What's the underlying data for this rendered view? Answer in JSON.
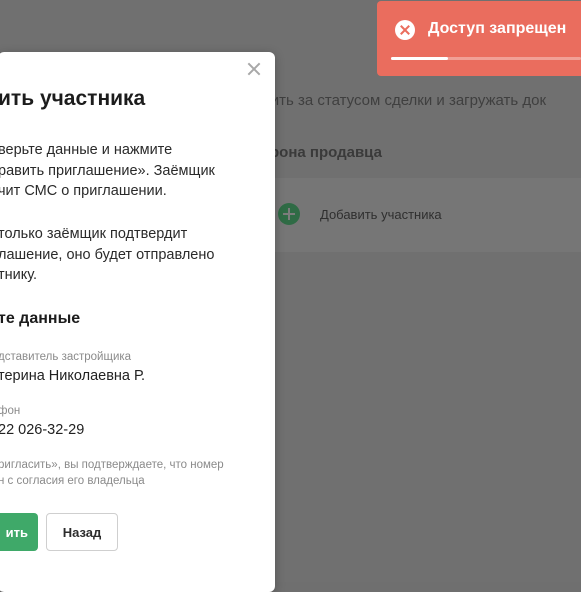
{
  "background": {
    "intro_text": "дить за статусом сделки и загружать док",
    "section_title": "рона продавца",
    "add_participant_label": "Добавить участника"
  },
  "modal": {
    "title": "ить участника",
    "paragraph1": [
      "верьте данные и нажмите",
      "равить приглашение». Заёмщик",
      "чит СМС о приглашении."
    ],
    "paragraph2": [
      "только заёмщик подтвердит",
      "лашение, оно будет отправлено",
      "тнику."
    ],
    "section_heading": "те данные",
    "fields": [
      {
        "label": "дставитель застройщика",
        "value": "терина Николаевна Р."
      },
      {
        "label": "фон",
        "value": "22 026-32-29"
      }
    ],
    "note": [
      "ригласить», вы подтверждаете, что номер",
      "н с согласия его владельца"
    ],
    "primary_button": "ить",
    "back_button": "Назад"
  },
  "toast": {
    "text": "Доступ запрещен",
    "progress": 0.3,
    "color": "#ea6d5e"
  }
}
